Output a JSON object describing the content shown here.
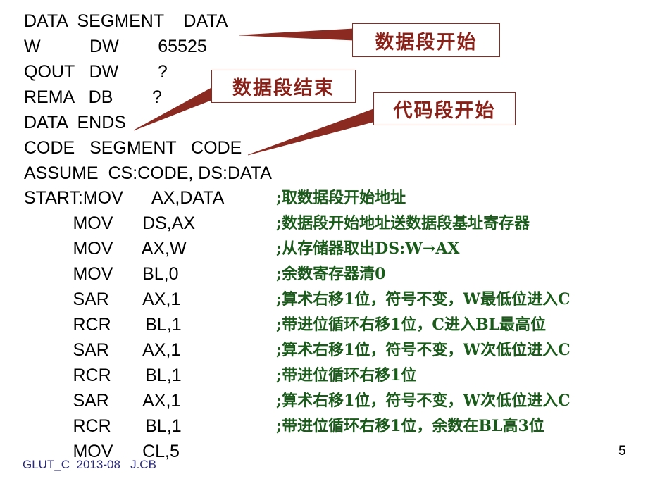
{
  "slide": {
    "page_number": "5",
    "footer": "GLUT_C  2013-08   J.CB",
    "accent_colors": {
      "code_text": "#000000",
      "comment_green": "#1a5a1a",
      "callout_red": "#8a2118",
      "callout_border": "#8a2a20",
      "footer_blue": "#2a2a7a",
      "background": "#ffffff"
    }
  },
  "code": {
    "lines": [
      {
        "label": "DATA",
        "op": "SEGMENT",
        "operand": "DATA",
        "comment": ""
      },
      {
        "label": "W",
        "op": "DW",
        "operand": "65525",
        "comment": ""
      },
      {
        "label": "QOUT",
        "op": "DW",
        "operand": "?",
        "comment": ""
      },
      {
        "label": "REMA",
        "op": "DB",
        "operand": "?",
        "comment": ""
      },
      {
        "label": "DATA",
        "op": "ENDS",
        "operand": "",
        "comment": ""
      },
      {
        "label": "CODE",
        "op": "SEGMENT",
        "operand": "CODE",
        "comment": ""
      },
      {
        "label": "ASSUME",
        "op": "CS:CODE, DS:DATA",
        "operand": "",
        "comment": ""
      },
      {
        "label": "START:MOV",
        "op": "",
        "operand": "AX,DATA",
        "comment": ";取数据段开始地址"
      },
      {
        "label": "",
        "op": "MOV",
        "operand": "DS,AX",
        "comment": ";数据段开始地址送数据段基址寄存器"
      },
      {
        "label": "",
        "op": "MOV",
        "operand": "AX,W",
        "comment": ";从存储器取出DS:W→AX"
      },
      {
        "label": "",
        "op": "MOV",
        "operand": "BL,0",
        "comment": ";余数寄存器清0"
      },
      {
        "label": "",
        "op": "SAR",
        "operand": "AX,1",
        "comment": ";算术右移1位，符号不变，W最低位进入C"
      },
      {
        "label": "",
        "op": "RCR",
        "operand": "BL,1",
        "comment": ";带进位循环右移1位，C进入BL最高位"
      },
      {
        "label": "",
        "op": "SAR",
        "operand": "AX,1",
        "comment": ";算术右移1位，符号不变，W次低位进入C"
      },
      {
        "label": "",
        "op": "RCR",
        "operand": "BL,1",
        "comment": ";带进位循环右移1位"
      },
      {
        "label": "",
        "op": "SAR",
        "operand": "AX,1",
        "comment": ";算术右移1位，符号不变，W次低位进入C"
      },
      {
        "label": "",
        "op": "RCR",
        "operand": "BL,1",
        "comment": ";带进位循环右移1位，余数在BL高3位"
      },
      {
        "label": "",
        "op": "MOV",
        "operand": "CL,5",
        "comment": ""
      }
    ],
    "rendered_lines": [
      "DATA  SEGMENT    DATA",
      "W          DW        65525",
      "QOUT   DW        ?",
      "REMA   DB        ?",
      "DATA  ENDS",
      "CODE   SEGMENT   CODE",
      "ASSUME  CS:CODE, DS:DATA",
      "START:MOV      AX,DATA",
      "          MOV      DS,AX",
      "          MOV      AX,W",
      "          MOV      BL,0",
      "          SAR       AX,1",
      "          RCR       BL,1",
      "          SAR       AX,1",
      "          RCR       BL,1",
      "          SAR       AX,1",
      "          RCR       BL,1",
      "          MOV      CL,5"
    ],
    "comments": [
      ";取数据段开始地址",
      ";数据段开始地址送数据段基址寄存器",
      ";从存储器取出DS:W→AX",
      ";余数寄存器清0",
      ";算术右移1位，符号不变，W最低位进入C",
      ";带进位循环右移1位，C进入BL最高位",
      ";算术右移1位，符号不变，W次低位进入C",
      ";带进位循环右移1位",
      ";算术右移1位，符号不变，W次低位进入C",
      ";带进位循环右移1位，余数在BL高3位"
    ]
  },
  "callouts": [
    {
      "label": "数据段开始",
      "target": "DATA SEGMENT DATA"
    },
    {
      "label": "数据段结束",
      "target": "DATA ENDS"
    },
    {
      "label": "代码段开始",
      "target": "CODE SEGMENT CODE"
    }
  ]
}
